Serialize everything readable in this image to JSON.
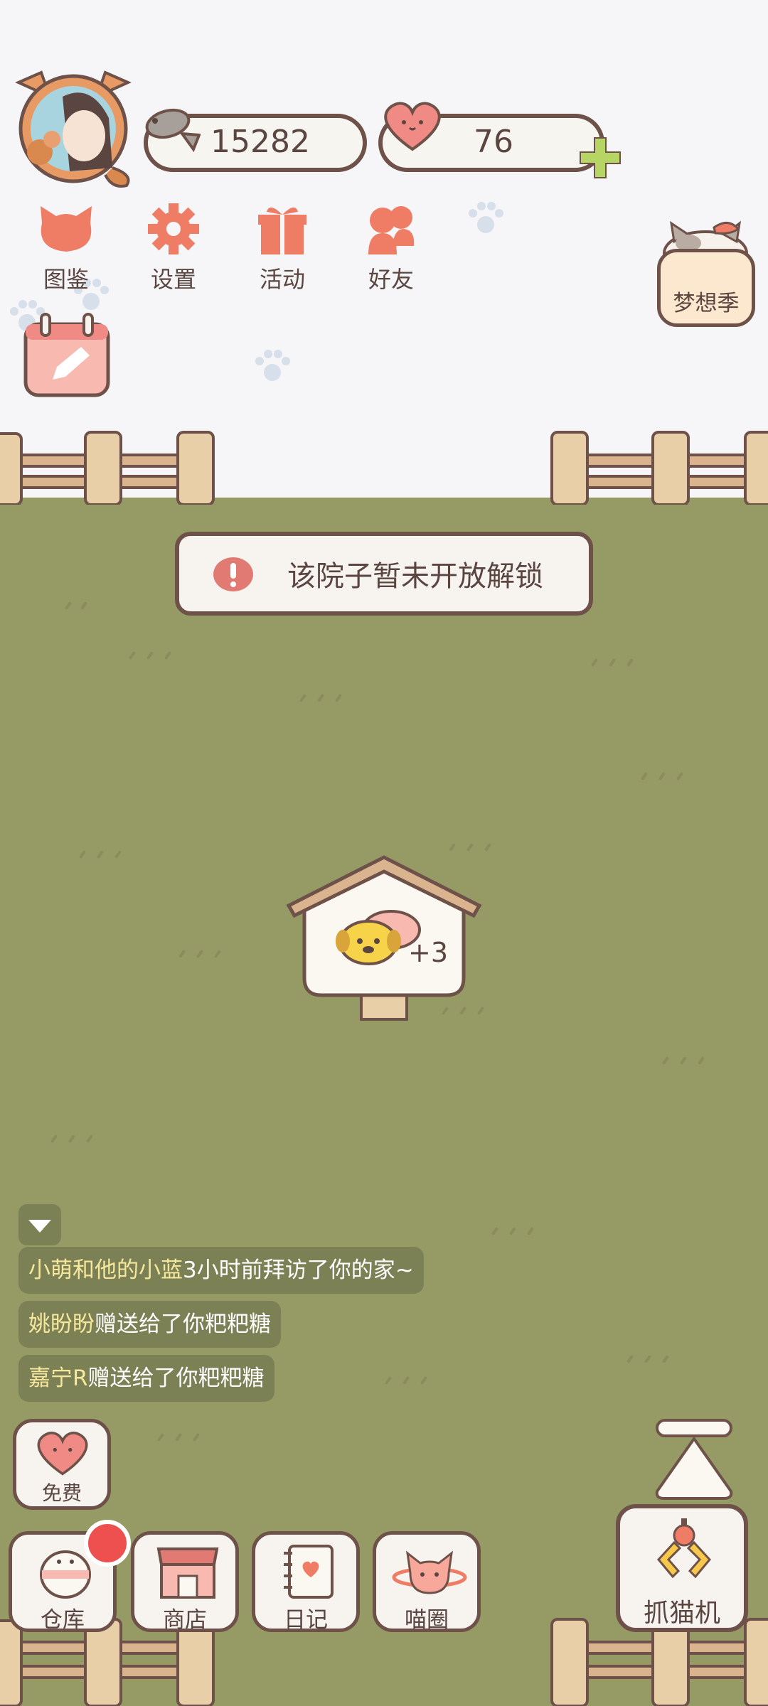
{
  "header": {
    "fish_count": "15282",
    "heart_count": "76"
  },
  "menu": [
    {
      "label": "图鉴"
    },
    {
      "label": "设置"
    },
    {
      "label": "活动"
    },
    {
      "label": "好友"
    }
  ],
  "dream_season": {
    "label": "梦想季"
  },
  "notice": {
    "text": "该院子暂未开放解锁"
  },
  "house": {
    "badge": "+3"
  },
  "feed": [
    {
      "name": "小萌和他的小蓝",
      "text": "3小时前拜访了你的家~"
    },
    {
      "name": "姚盼盼",
      "text": "赠送给了你粑粑糖"
    },
    {
      "name": "嘉宁R",
      "text": "赠送给了你粑粑糖"
    }
  ],
  "free_button": {
    "label": "免费"
  },
  "bottom_nav": [
    {
      "label": "仓库"
    },
    {
      "label": "商店"
    },
    {
      "label": "日记"
    },
    {
      "label": "喵圈"
    }
  ],
  "claw_machine": {
    "label": "抓猫机"
  },
  "colors": {
    "grass": "#969a65",
    "outline": "#6e524a",
    "accent": "#ef6f5f",
    "plus": "#b7d564"
  }
}
